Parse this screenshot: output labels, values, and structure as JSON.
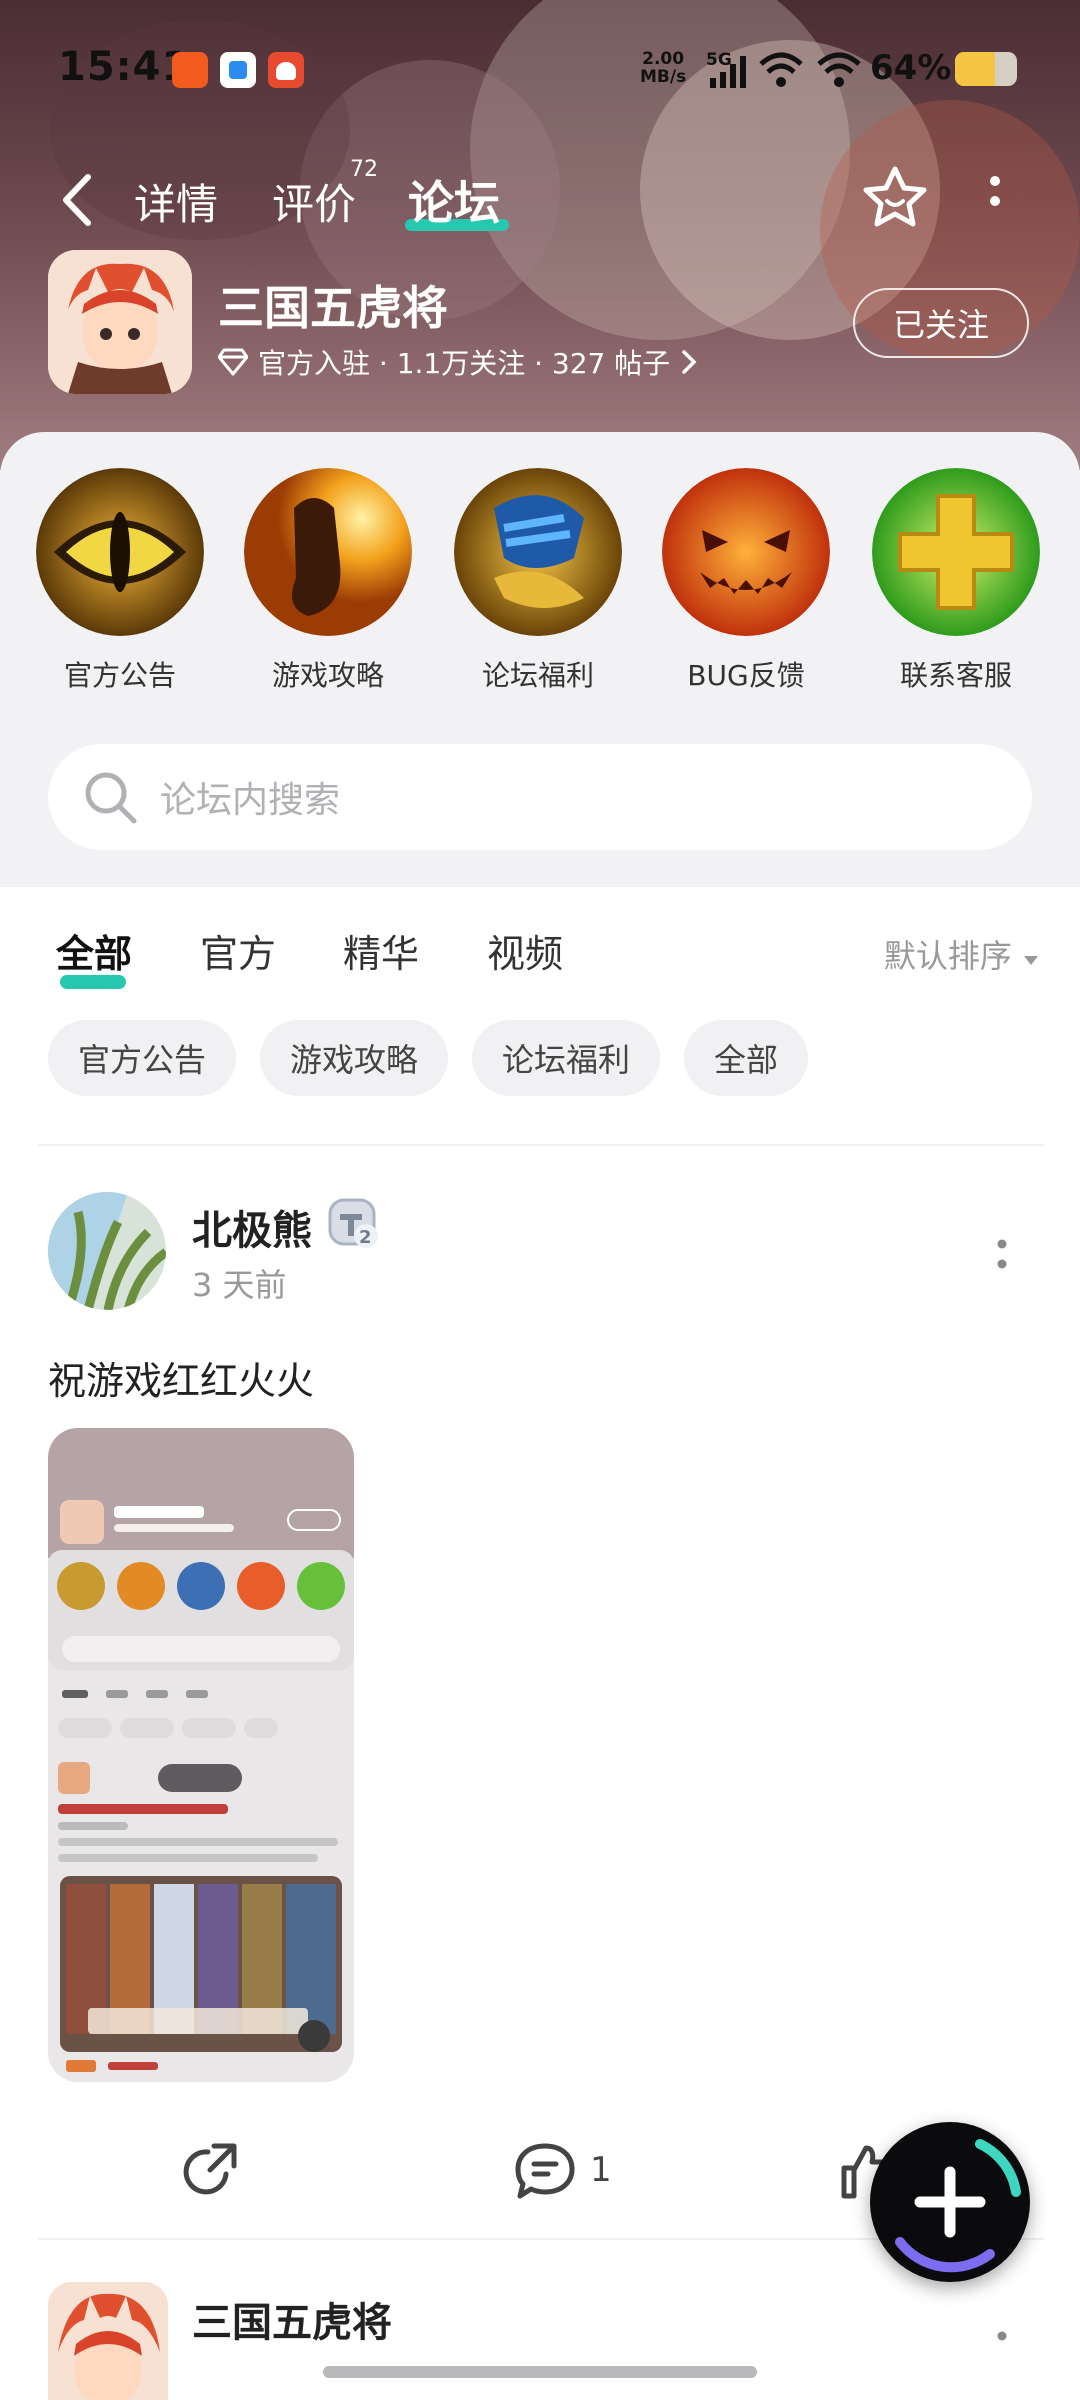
{
  "status_bar": {
    "time": "15:41",
    "net_speed": "2.00",
    "net_unit": "MB/s",
    "network": "5G",
    "battery": "64%",
    "battery_level": 0.64
  },
  "nav": {
    "tabs": [
      "详情",
      "评价",
      "论坛"
    ],
    "active_tab": "论坛",
    "review_count": "72"
  },
  "game": {
    "name": "三国五虎将",
    "meta": "官方入驻 · 1.1万关注 · 327 帖子",
    "follow_label": "已关注"
  },
  "categories": [
    {
      "label": "官方公告",
      "icon": "eye-icon"
    },
    {
      "label": "游戏攻略",
      "icon": "strategy-icon"
    },
    {
      "label": "论坛福利",
      "icon": "gift-icon"
    },
    {
      "label": "BUG反馈",
      "icon": "pumpkin-icon"
    },
    {
      "label": "联系客服",
      "icon": "plus-icon"
    }
  ],
  "search": {
    "placeholder": "论坛内搜索"
  },
  "filter_tabs": [
    "全部",
    "官方",
    "精华",
    "视频"
  ],
  "sort_label": "默认排序",
  "chips": [
    "官方公告",
    "游戏攻略",
    "论坛福利",
    "全部"
  ],
  "post": {
    "author": "北极熊",
    "level": "2",
    "time": "3 天前",
    "content": "祝游戏红红火火",
    "comment_count": "1"
  },
  "next_post": {
    "author": "三国五虎将"
  }
}
